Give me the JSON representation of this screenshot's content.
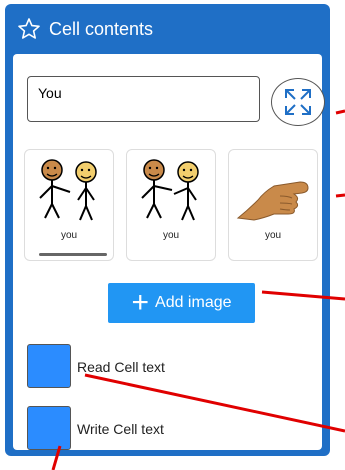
{
  "header": {
    "title": "Cell contents",
    "icon": "star-icon"
  },
  "text_field": {
    "value": "You"
  },
  "expand_button": {
    "icon": "expand-arrows-icon"
  },
  "images": [
    {
      "caption": "you",
      "icon": "two-people-pointing-icon",
      "selected": true
    },
    {
      "caption": "you",
      "icon": "two-people-pointing-icon",
      "selected": false
    },
    {
      "caption": "you",
      "icon": "hand-pointing-icon",
      "selected": false
    }
  ],
  "add_image": {
    "label": "Add image",
    "icon": "plus-icon"
  },
  "read_cell": {
    "label": "Read Cell text"
  },
  "write_cell": {
    "label": "Write Cell text"
  },
  "colors": {
    "header_blue": "#1f6fc6",
    "button_blue": "#2196f3",
    "checkbox_blue": "#2b8cff",
    "annotation_red": "#e00000"
  }
}
